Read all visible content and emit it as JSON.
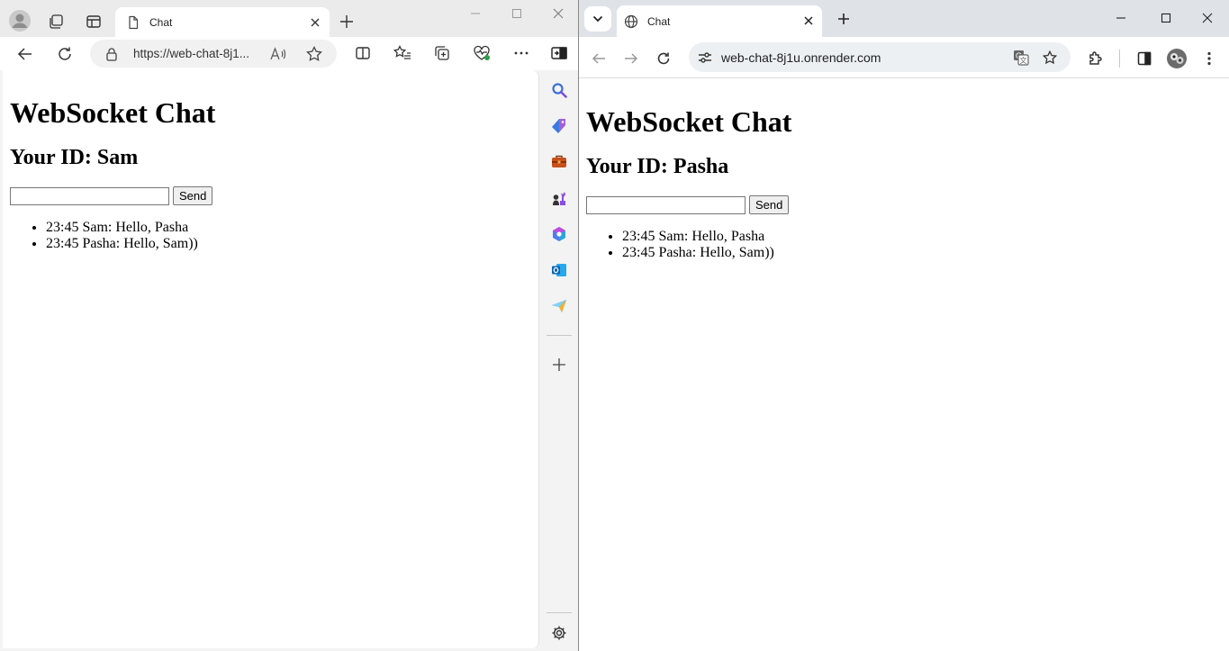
{
  "left_window": {
    "tab_title": "Chat",
    "url": "https://web-chat-8j1...",
    "page": {
      "heading": "WebSocket Chat",
      "your_id": "Your ID: Sam",
      "input_value": "",
      "send_label": "Send",
      "messages": [
        "23:45 Sam: Hello, Pasha",
        "23:45 Pasha: Hello, Sam))"
      ]
    },
    "sidebar_icons": [
      "search-icon",
      "tag-icon",
      "briefcase-icon",
      "chess-icon",
      "copilot-icon",
      "outlook-icon",
      "send-icon",
      "add-icon",
      "settings-icon"
    ]
  },
  "right_window": {
    "tab_title": "Chat",
    "url": "web-chat-8j1u.onrender.com",
    "page": {
      "heading": "WebSocket Chat",
      "your_id": "Your ID: Pasha",
      "input_value": "",
      "send_label": "Send",
      "messages": [
        "23:45 Sam: Hello, Pasha",
        "23:45 Pasha: Hello, Sam))"
      ]
    }
  }
}
